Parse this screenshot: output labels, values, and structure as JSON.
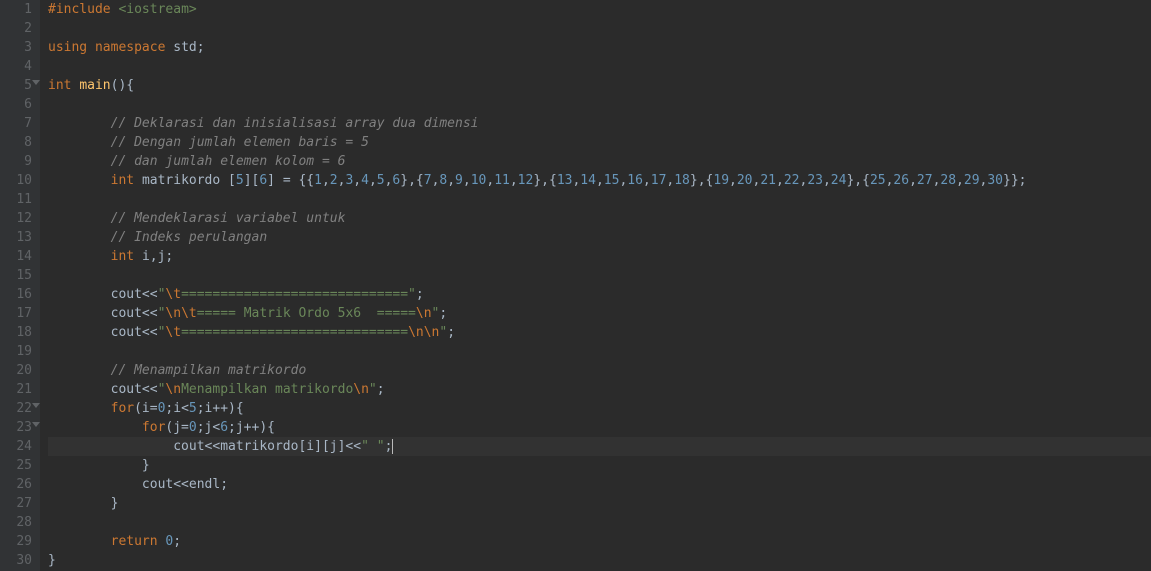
{
  "chart_data": null,
  "editor": {
    "active_line": 24,
    "line_count": 30
  },
  "lines": {
    "1": {
      "tokens": [
        [
          "#include ",
          "pp"
        ],
        [
          "<iostream>",
          "inc"
        ]
      ]
    },
    "2": {
      "tokens": []
    },
    "3": {
      "tokens": [
        [
          "using ",
          "kw"
        ],
        [
          "namespace ",
          "kw"
        ],
        [
          "std",
          "id"
        ],
        [
          ";",
          "pl"
        ]
      ]
    },
    "4": {
      "tokens": []
    },
    "5": {
      "tokens": [
        [
          "int ",
          "ty"
        ],
        [
          "main",
          "fn"
        ],
        [
          "(){",
          "pl"
        ]
      ],
      "fold": true
    },
    "6": {
      "tokens": []
    },
    "7": {
      "tokens": [
        [
          "        ",
          "pl"
        ],
        [
          "// Deklarasi dan inisialisasi array dua dimensi",
          "com"
        ]
      ]
    },
    "8": {
      "tokens": [
        [
          "        ",
          "pl"
        ],
        [
          "// Dengan jumlah elemen baris = 5",
          "com"
        ]
      ]
    },
    "9": {
      "tokens": [
        [
          "        ",
          "pl"
        ],
        [
          "// dan jumlah elemen kolom = 6",
          "com"
        ]
      ]
    },
    "10": {
      "tokens": [
        [
          "        ",
          "pl"
        ],
        [
          "int ",
          "ty"
        ],
        [
          "matrikordo [",
          "id"
        ],
        [
          "5",
          "num"
        ],
        [
          "][",
          "pl"
        ],
        [
          "6",
          "num"
        ],
        [
          "] = {{",
          "pl"
        ],
        [
          "1",
          "num"
        ],
        [
          ",",
          "pl"
        ],
        [
          "2",
          "num"
        ],
        [
          ",",
          "pl"
        ],
        [
          "3",
          "num"
        ],
        [
          ",",
          "pl"
        ],
        [
          "4",
          "num"
        ],
        [
          ",",
          "pl"
        ],
        [
          "5",
          "num"
        ],
        [
          ",",
          "pl"
        ],
        [
          "6",
          "num"
        ],
        [
          "},{",
          "pl"
        ],
        [
          "7",
          "num"
        ],
        [
          ",",
          "pl"
        ],
        [
          "8",
          "num"
        ],
        [
          ",",
          "pl"
        ],
        [
          "9",
          "num"
        ],
        [
          ",",
          "pl"
        ],
        [
          "10",
          "num"
        ],
        [
          ",",
          "pl"
        ],
        [
          "11",
          "num"
        ],
        [
          ",",
          "pl"
        ],
        [
          "12",
          "num"
        ],
        [
          "},{",
          "pl"
        ],
        [
          "13",
          "num"
        ],
        [
          ",",
          "pl"
        ],
        [
          "14",
          "num"
        ],
        [
          ",",
          "pl"
        ],
        [
          "15",
          "num"
        ],
        [
          ",",
          "pl"
        ],
        [
          "16",
          "num"
        ],
        [
          ",",
          "pl"
        ],
        [
          "17",
          "num"
        ],
        [
          ",",
          "pl"
        ],
        [
          "18",
          "num"
        ],
        [
          "},{",
          "pl"
        ],
        [
          "19",
          "num"
        ],
        [
          ",",
          "pl"
        ],
        [
          "20",
          "num"
        ],
        [
          ",",
          "pl"
        ],
        [
          "21",
          "num"
        ],
        [
          ",",
          "pl"
        ],
        [
          "22",
          "num"
        ],
        [
          ",",
          "pl"
        ],
        [
          "23",
          "num"
        ],
        [
          ",",
          "pl"
        ],
        [
          "24",
          "num"
        ],
        [
          "},{",
          "pl"
        ],
        [
          "25",
          "num"
        ],
        [
          ",",
          "pl"
        ],
        [
          "26",
          "num"
        ],
        [
          ",",
          "pl"
        ],
        [
          "27",
          "num"
        ],
        [
          ",",
          "pl"
        ],
        [
          "28",
          "num"
        ],
        [
          ",",
          "pl"
        ],
        [
          "29",
          "num"
        ],
        [
          ",",
          "pl"
        ],
        [
          "30",
          "num"
        ],
        [
          "}};",
          "pl"
        ]
      ]
    },
    "11": {
      "tokens": []
    },
    "12": {
      "tokens": [
        [
          "        ",
          "pl"
        ],
        [
          "// Mendeklarasi variabel untuk",
          "com"
        ]
      ]
    },
    "13": {
      "tokens": [
        [
          "        ",
          "pl"
        ],
        [
          "// Indeks perulangan",
          "com"
        ]
      ]
    },
    "14": {
      "tokens": [
        [
          "        ",
          "pl"
        ],
        [
          "int ",
          "ty"
        ],
        [
          "i,j;",
          "id"
        ]
      ]
    },
    "15": {
      "tokens": []
    },
    "16": {
      "tokens": [
        [
          "        ",
          "pl"
        ],
        [
          "cout<<",
          "id"
        ],
        [
          "\"",
          "str"
        ],
        [
          "\\t",
          "esc"
        ],
        [
          "=============================\"",
          "str"
        ],
        [
          ";",
          "pl"
        ]
      ]
    },
    "17": {
      "tokens": [
        [
          "        ",
          "pl"
        ],
        [
          "cout<<",
          "id"
        ],
        [
          "\"",
          "str"
        ],
        [
          "\\n\\t",
          "esc"
        ],
        [
          "===== Matrik Ordo 5x6  =====",
          "str"
        ],
        [
          "\\n",
          "esc"
        ],
        [
          "\"",
          "str"
        ],
        [
          ";",
          "pl"
        ]
      ]
    },
    "18": {
      "tokens": [
        [
          "        ",
          "pl"
        ],
        [
          "cout<<",
          "id"
        ],
        [
          "\"",
          "str"
        ],
        [
          "\\t",
          "esc"
        ],
        [
          "=============================",
          "str"
        ],
        [
          "\\n\\n",
          "esc"
        ],
        [
          "\"",
          "str"
        ],
        [
          ";",
          "pl"
        ]
      ]
    },
    "19": {
      "tokens": []
    },
    "20": {
      "tokens": [
        [
          "        ",
          "pl"
        ],
        [
          "// Menampilkan matrikordo",
          "com"
        ]
      ]
    },
    "21": {
      "tokens": [
        [
          "        ",
          "pl"
        ],
        [
          "cout<<",
          "id"
        ],
        [
          "\"",
          "str"
        ],
        [
          "\\n",
          "esc"
        ],
        [
          "Menampilkan matrikordo",
          "str"
        ],
        [
          "\\n",
          "esc"
        ],
        [
          "\"",
          "str"
        ],
        [
          ";",
          "pl"
        ]
      ]
    },
    "22": {
      "tokens": [
        [
          "        ",
          "pl"
        ],
        [
          "for",
          "kw"
        ],
        [
          "(i=",
          "pl"
        ],
        [
          "0",
          "num"
        ],
        [
          ";i<",
          "pl"
        ],
        [
          "5",
          "num"
        ],
        [
          ";i++){",
          "pl"
        ]
      ],
      "fold": true
    },
    "23": {
      "tokens": [
        [
          "            ",
          "pl"
        ],
        [
          "for",
          "kw"
        ],
        [
          "(j=",
          "pl"
        ],
        [
          "0",
          "num"
        ],
        [
          ";j<",
          "pl"
        ],
        [
          "6",
          "num"
        ],
        [
          ";j++){",
          "pl"
        ]
      ],
      "fold": true
    },
    "24": {
      "tokens": [
        [
          "                ",
          "pl"
        ],
        [
          "cout<<matrikordo[i][j]<<",
          "id"
        ],
        [
          "\" \"",
          "str"
        ],
        [
          ";",
          "pl"
        ]
      ],
      "active": true,
      "cursor": true
    },
    "25": {
      "tokens": [
        [
          "            }",
          "pl"
        ]
      ]
    },
    "26": {
      "tokens": [
        [
          "            ",
          "pl"
        ],
        [
          "cout<<endl;",
          "id"
        ]
      ]
    },
    "27": {
      "tokens": [
        [
          "        }",
          "pl"
        ]
      ]
    },
    "28": {
      "tokens": []
    },
    "29": {
      "tokens": [
        [
          "        ",
          "pl"
        ],
        [
          "return ",
          "kw"
        ],
        [
          "0",
          "num"
        ],
        [
          ";",
          "pl"
        ]
      ]
    },
    "30": {
      "tokens": [
        [
          "}",
          "pl"
        ]
      ]
    }
  }
}
